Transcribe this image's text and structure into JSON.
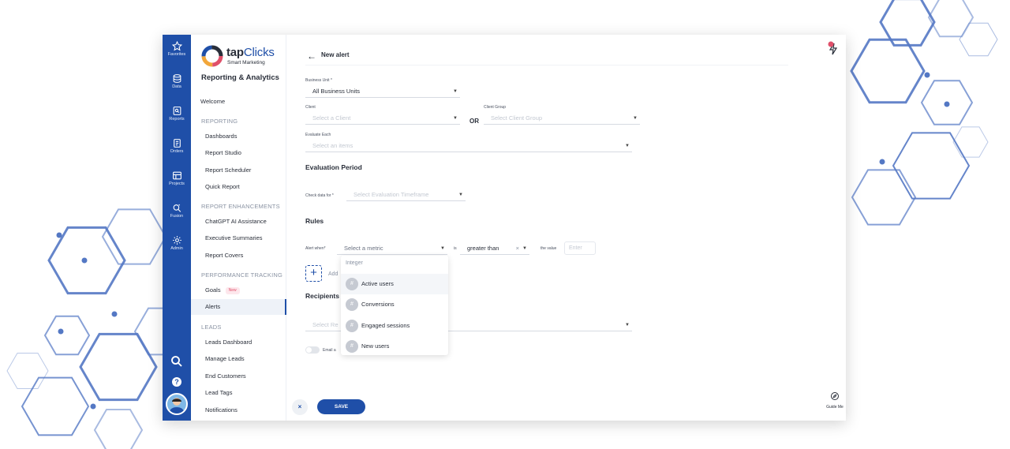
{
  "rail": {
    "items": [
      {
        "label": "Favorites",
        "icon": "star-icon"
      },
      {
        "label": "Data",
        "icon": "database-icon"
      },
      {
        "label": "Reports",
        "icon": "reports-icon"
      },
      {
        "label": "Orders",
        "icon": "orders-icon"
      },
      {
        "label": "Projects",
        "icon": "projects-icon"
      },
      {
        "label": "Fusion",
        "icon": "fusion-icon"
      },
      {
        "label": "Admin",
        "icon": "gear-icon"
      }
    ],
    "help": "?"
  },
  "brand": {
    "name_bold": "tap",
    "name_light": "Clicks",
    "tagline": "Smart Marketing",
    "app_title": "Reporting & Analytics"
  },
  "nav": {
    "welcome": "Welcome",
    "sections": {
      "reporting": "REPORTING",
      "enhancements": "REPORT ENHANCEMENTS",
      "performance": "PERFORMANCE TRACKING",
      "leads": "LEADS"
    },
    "reporting_items": [
      "Dashboards",
      "Report Studio",
      "Report Scheduler",
      "Quick Report"
    ],
    "enhancement_items": [
      "ChatGPT AI Assistance",
      "Executive Summaries",
      "Report Covers"
    ],
    "performance_items": [
      {
        "label": "Goals",
        "badge": "New"
      },
      {
        "label": "Alerts"
      }
    ],
    "leads_items": [
      "Leads Dashboard",
      "Manage Leads",
      "End Customers",
      "Lead Tags",
      "Notifications"
    ]
  },
  "page": {
    "back_arrow": "←",
    "title": "New alert"
  },
  "form": {
    "business_unit": {
      "label": "Business Unit *",
      "value": "All Business Units"
    },
    "client": {
      "label": "Client",
      "placeholder": "Select a Client"
    },
    "or_text": "OR",
    "client_group": {
      "label": "Client Group",
      "placeholder": "Select Client Group"
    },
    "evaluate_each": {
      "label": "Evaluate Each",
      "placeholder": "Select an items"
    },
    "evaluation_period": {
      "title": "Evaluation Period",
      "check_label": "Check data for *",
      "placeholder": "Select Evaluation Timeframe"
    },
    "rules": {
      "title": "Rules",
      "alert_when_label": "Alert when*",
      "metric_placeholder": "Select a metric",
      "is_label": "is",
      "operator": "greater than",
      "clear": "×",
      "value_label": "the value",
      "value_placeholder": "Enter",
      "add_label": "Add"
    },
    "recipients": {
      "title": "Recipients",
      "placeholder": "Select Re",
      "email_label": "Email a"
    }
  },
  "metric_dropdown": {
    "group": "Integer",
    "options": [
      "Active users",
      "Conversions",
      "Engaged sessions",
      "New users"
    ],
    "hovered_index": 0
  },
  "footer": {
    "cancel": "×",
    "save": "SAVE",
    "guide": "Guide Me"
  },
  "colors": {
    "primary": "#1f4fa8",
    "notification": "#e0506a",
    "hex_decor": "#5478c4"
  }
}
